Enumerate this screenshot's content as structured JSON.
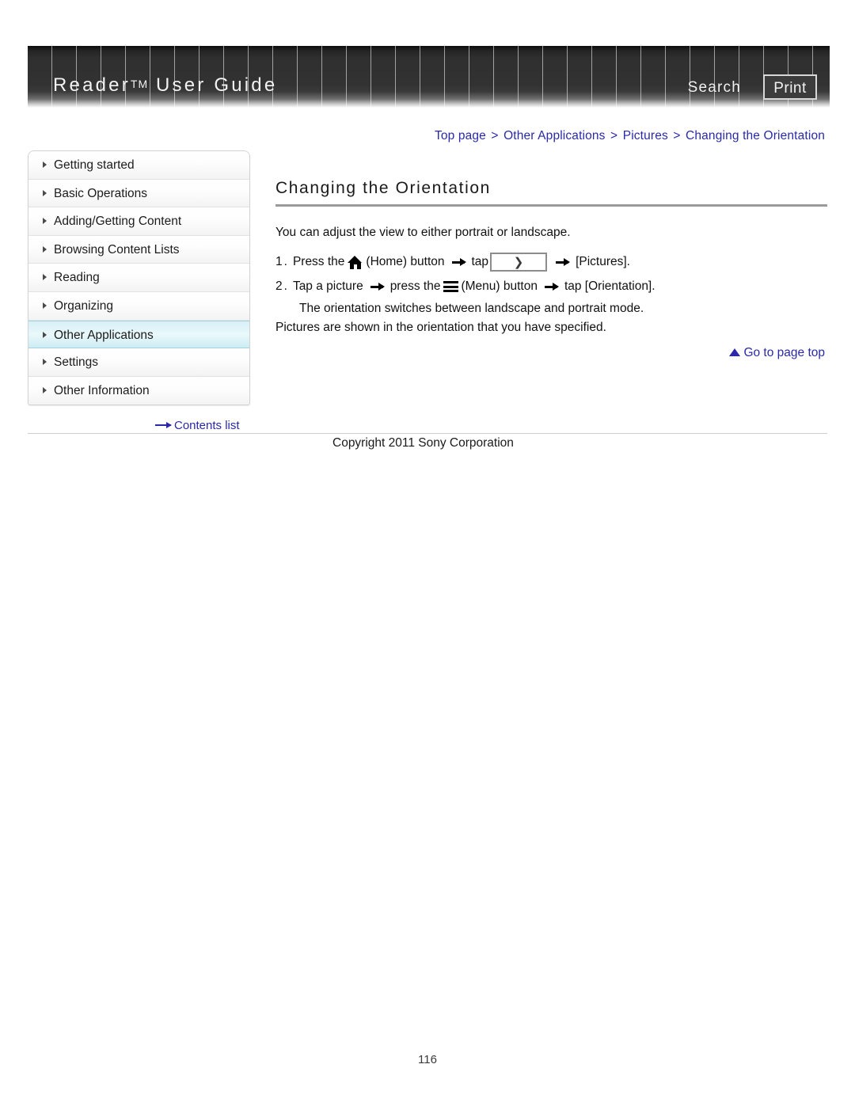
{
  "header": {
    "title_main": "Reader",
    "title_tm": "TM",
    "title_rest": "User Guide",
    "search_label": "Search",
    "print_label": "Print"
  },
  "breadcrumb": {
    "items": [
      "Top page",
      "Other Applications",
      "Pictures",
      "Changing the Orientation"
    ],
    "separator": ">"
  },
  "sidebar": {
    "items": [
      {
        "label": "Getting started",
        "active": false
      },
      {
        "label": "Basic Operations",
        "active": false
      },
      {
        "label": "Adding/Getting Content",
        "active": false
      },
      {
        "label": "Browsing Content Lists",
        "active": false
      },
      {
        "label": "Reading",
        "active": false
      },
      {
        "label": "Organizing",
        "active": false
      },
      {
        "label": "Other Applications",
        "active": true
      },
      {
        "label": "Settings",
        "active": false
      },
      {
        "label": "Other Information",
        "active": false
      }
    ],
    "contents_link": "Contents list"
  },
  "main": {
    "heading": "Changing the Orientation",
    "intro": "You can adjust the view to either portrait or landscape.",
    "step1": {
      "number": "1.",
      "text_a": "Press the",
      "text_b": "(Home) button",
      "text_c": "tap",
      "box_glyph": "❯",
      "text_d": "[Pictures]."
    },
    "step2": {
      "number": "2.",
      "text_a": "Tap a picture",
      "text_b": "press the",
      "text_c": "(Menu) button",
      "text_d": "tap [Orientation].",
      "sub": "The orientation switches between landscape and portrait mode."
    },
    "trailing": "Pictures are shown in the orientation that you have specified.",
    "goto_top": "Go to page top"
  },
  "footer": {
    "copyright": "Copyright 2011 Sony Corporation",
    "page_number": "116"
  },
  "colors": {
    "link": "#2a2aa8",
    "header_bg": "#2f2f2f",
    "active_nav": "#d7f0f6"
  }
}
